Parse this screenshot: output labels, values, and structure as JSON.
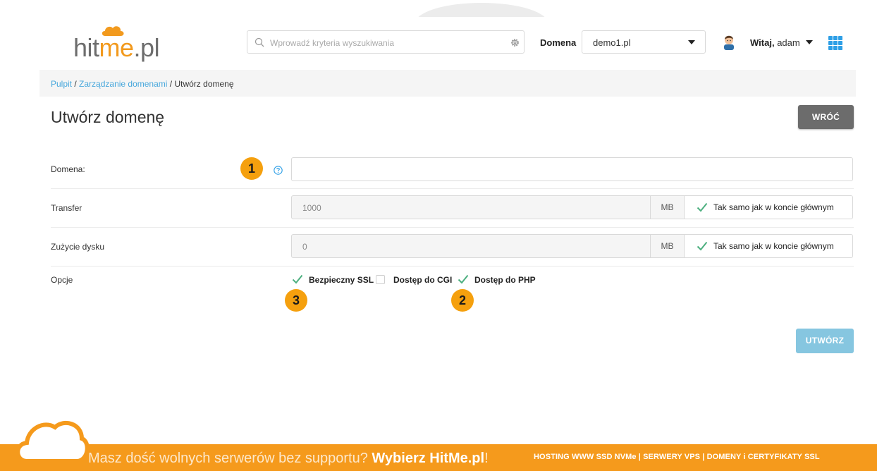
{
  "logo": {
    "part1": "hit",
    "part2": "me",
    "part3": ".pl"
  },
  "search": {
    "placeholder": "Wprowadź kryteria wyszukiwania"
  },
  "header": {
    "domain_label": "Domena",
    "domain_value": "demo1.pl",
    "greeting": "Witaj,",
    "username": "adam"
  },
  "breadcrumb": {
    "item1": "Pulpit",
    "sep1": " / ",
    "item2": "Zarządzanie domenami",
    "sep2": " / ",
    "current": "Utwórz domenę"
  },
  "page": {
    "title": "Utwórz domenę",
    "back_button": "WRÓĆ",
    "create_button": "UTWÓRZ"
  },
  "form": {
    "domain": {
      "label": "Domena:",
      "value": ""
    },
    "transfer": {
      "label": "Transfer",
      "value": "1000",
      "unit": "MB",
      "same_label": "Tak samo jak w koncie głównym",
      "same_checked": true
    },
    "disk": {
      "label": "Zużycie dysku",
      "value": "0",
      "unit": "MB",
      "same_label": "Tak samo jak w koncie głównym",
      "same_checked": true
    },
    "options": {
      "label": "Opcje",
      "ssl": {
        "label": "Bezpieczny SSL",
        "checked": true
      },
      "cgi": {
        "label": "Dostęp do CGI",
        "checked": false
      },
      "php": {
        "label": "Dostęp do PHP",
        "checked": true
      }
    }
  },
  "badges": {
    "b1": "1",
    "b2": "2",
    "b3": "3"
  },
  "footer": {
    "text_part1": "Masz dość wolnych serwerów bez supportu? ",
    "text_bold": "Wybierz HitMe.pl",
    "text_part2": "!",
    "right": "HOSTING WWW SSD NVMe | SERWERY VPS | DOMENY i CERTYFIKATY SSL"
  },
  "colors": {
    "accent": "#f59a1c",
    "link": "#46a7dc",
    "check": "#4caf7f",
    "badge": "#f5a00e",
    "create_btn": "#86c6e0",
    "back_btn": "#6c6c6c"
  }
}
